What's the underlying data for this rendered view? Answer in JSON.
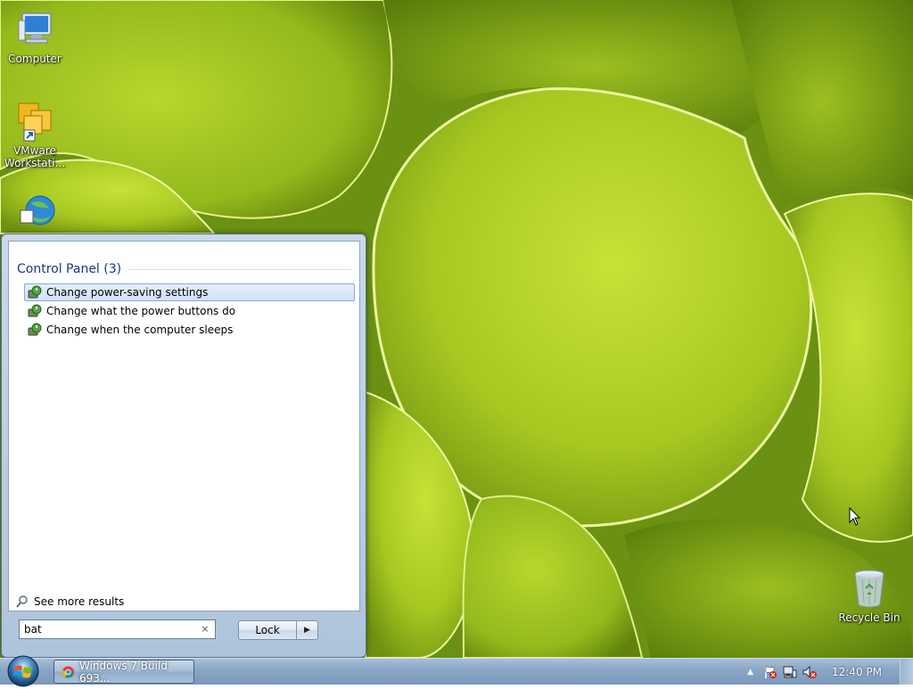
{
  "desktop": {
    "icons": [
      {
        "label": "Computer",
        "icon": "computer-icon"
      },
      {
        "label": "VMware Workstati...",
        "icon": "vmware-workstation-icon"
      },
      {
        "label": "",
        "icon": "internet-download-manager-icon"
      },
      {
        "label": "Recycle Bin",
        "icon": "recycle-bin-icon"
      }
    ]
  },
  "start_menu": {
    "section_header": "Control Panel (3)",
    "results": [
      {
        "label": "Change power-saving settings",
        "icon": "power-options-icon",
        "selected": true
      },
      {
        "label": "Change what the power buttons do",
        "icon": "power-options-icon",
        "selected": false
      },
      {
        "label": "Change when the computer sleeps",
        "icon": "power-options-icon",
        "selected": false
      }
    ],
    "see_more": "See more results",
    "search": {
      "value": "bat",
      "clear_glyph": "×"
    },
    "lock_button": "Lock",
    "lock_arrow_glyph": "▶"
  },
  "taskbar": {
    "task_button": "Windows 7 Build 693...",
    "tray_arrow": "▲",
    "clock": "12:40 PM"
  }
}
